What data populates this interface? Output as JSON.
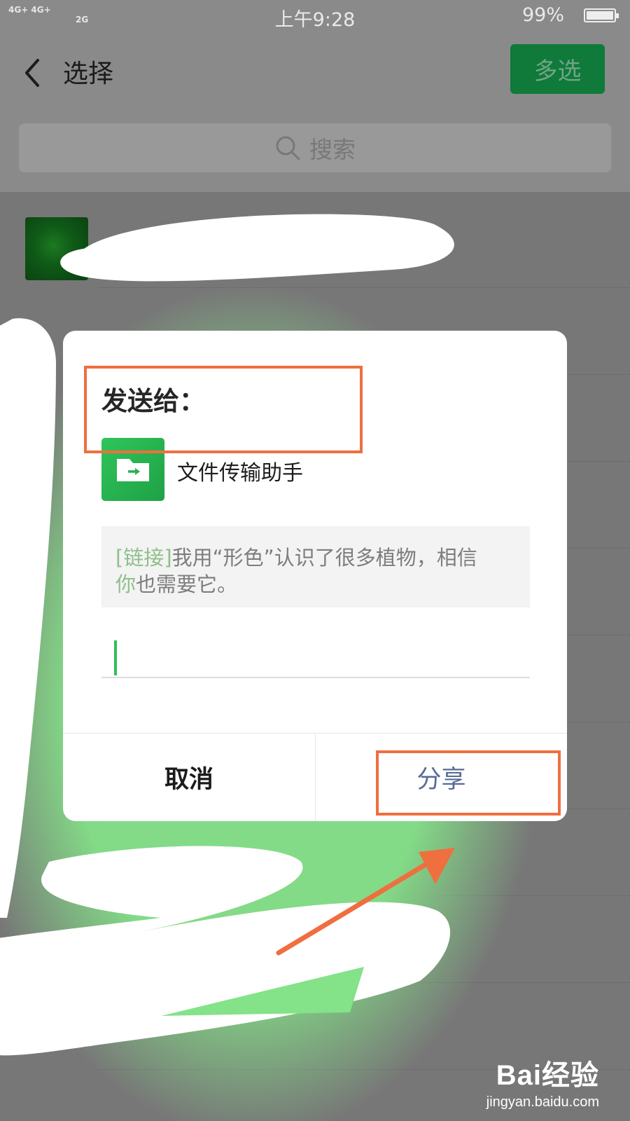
{
  "status_bar": {
    "signal_text_1": "4G+ 4G+",
    "signal_text_2": "2G",
    "time": "上午9:28",
    "battery": "99%"
  },
  "nav": {
    "title": "选择",
    "multi_select_label": "多选",
    "back_icon": "chevron-left-icon"
  },
  "search": {
    "placeholder": "搜索",
    "icon": "search-icon"
  },
  "dialog": {
    "title": "发送给：",
    "recipient_name": "文件传输助手",
    "recipient_icon": "folder-transfer-icon",
    "message_link_tag": "[链接]",
    "message_text_1": "我用“形色”认识了很多植物，相信",
    "message_text_2_green": "你",
    "message_text_2": "也需要它。",
    "cancel_label": "取消",
    "share_label": "分享"
  },
  "annotations": {
    "highlight_color": "#ef6f3e",
    "doodle_color": "#84e288"
  },
  "watermark": {
    "brand": "Bai经验",
    "url": "jingyan.baidu.com"
  },
  "colors": {
    "wechat_green": "#1aad19",
    "link_blue": "#576b95"
  }
}
